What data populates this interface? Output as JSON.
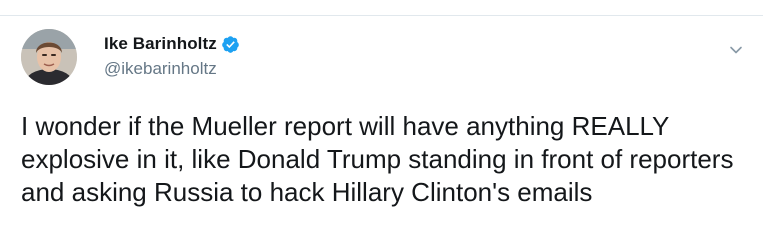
{
  "tweet": {
    "author": {
      "display_name": "Ike Barinholtz",
      "handle": "@ikebarinholtz",
      "verified": true
    },
    "text": "I wonder if the Mueller report will have anything REALLY explosive in it, like Donald Trump standing in front of reporters and asking Russia to hack Hillary Clinton's emails",
    "icons": {
      "verified": "verified-badge-icon",
      "menu": "chevron-down-icon"
    }
  },
  "colors": {
    "verified_blue": "#1da1f2",
    "text_primary": "#14171a",
    "text_secondary": "#657786",
    "divider": "#e1e8ed"
  }
}
